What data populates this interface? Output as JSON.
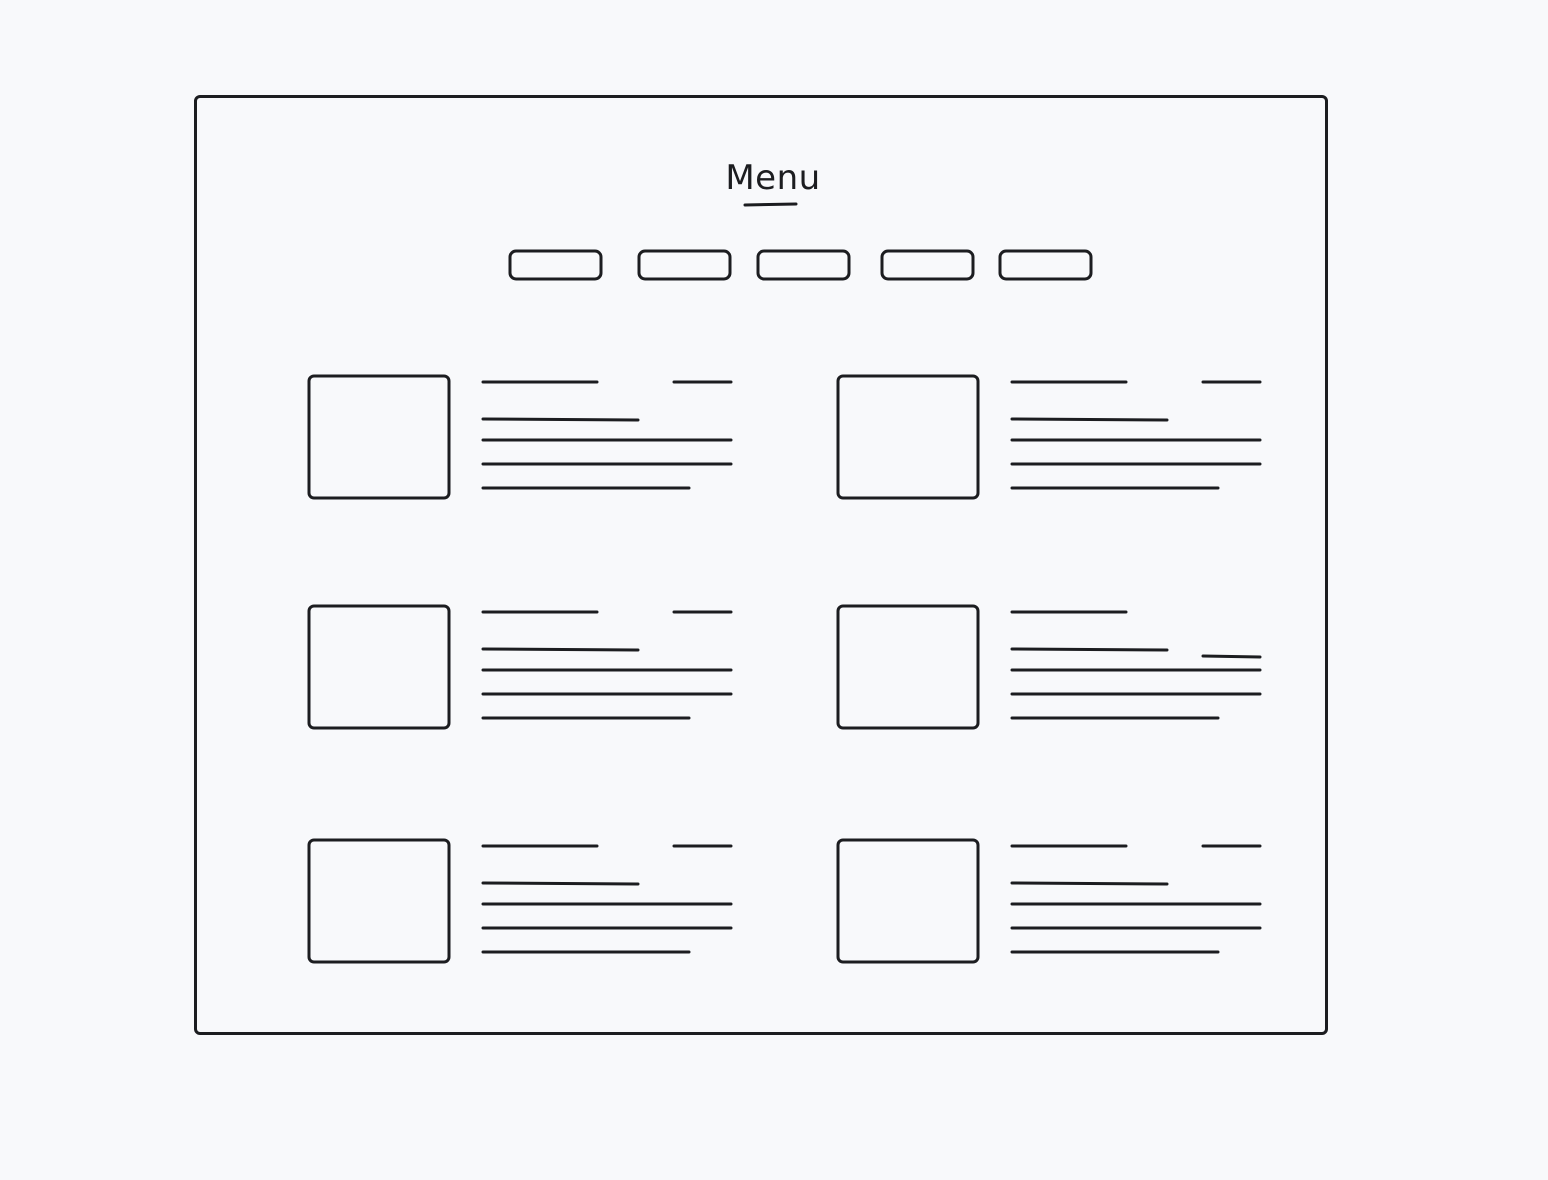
{
  "colors": {
    "background": "#f8f9fb",
    "ink": "#1c1d20"
  },
  "header": {
    "title": "Menu",
    "title_underline_icon": "underline-stroke"
  },
  "nav": {
    "items": [
      {
        "name": "nav-button-1",
        "label": ""
      },
      {
        "name": "nav-button-2",
        "label": ""
      },
      {
        "name": "nav-button-3",
        "label": ""
      },
      {
        "name": "nav-button-4",
        "label": ""
      },
      {
        "name": "nav-button-5",
        "label": ""
      }
    ]
  },
  "menu_items": [
    {
      "name": "menu-item-1",
      "image_icon": "image-placeholder",
      "has_price": true
    },
    {
      "name": "menu-item-2",
      "image_icon": "image-placeholder",
      "has_price": true
    },
    {
      "name": "menu-item-3",
      "image_icon": "image-placeholder",
      "has_price": true
    },
    {
      "name": "menu-item-4",
      "image_icon": "image-placeholder",
      "has_price": true
    },
    {
      "name": "menu-item-5",
      "image_icon": "image-placeholder",
      "has_price": true
    },
    {
      "name": "menu-item-6",
      "image_icon": "image-placeholder",
      "has_price": true
    }
  ]
}
